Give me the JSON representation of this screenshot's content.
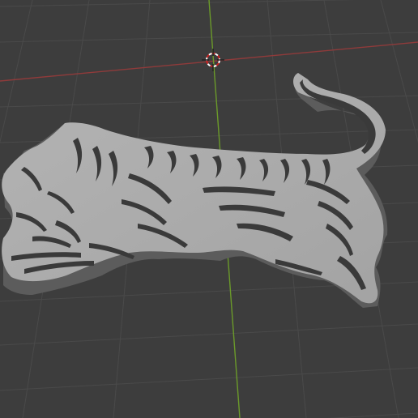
{
  "viewport": {
    "background_color": "#3d3d3d",
    "grid_color": "#494949",
    "x_axis_color": "#8f3b3b",
    "y_axis_color": "#6b9a2a",
    "cursor_icon": "3d-cursor-icon"
  },
  "model": {
    "shape": "tiger-relief-cutout",
    "face_color": "#adadad",
    "side_color": "#5c5c5c",
    "cutout_color": "#3a3a3a"
  }
}
